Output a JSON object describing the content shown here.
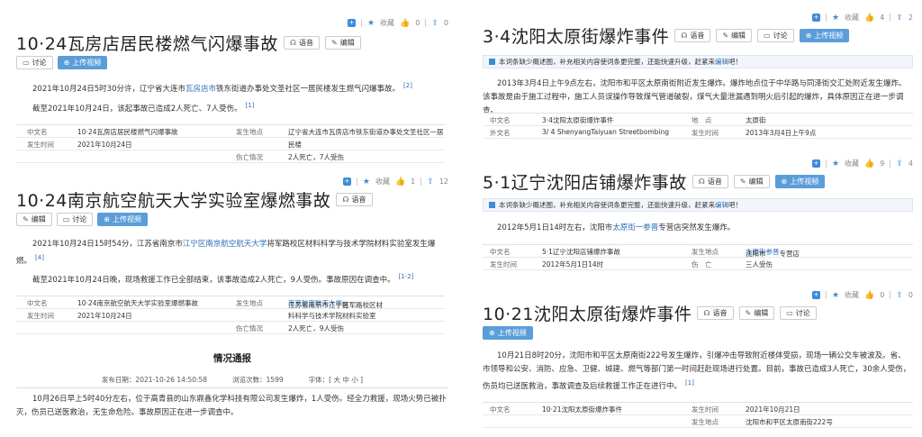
{
  "toolbar": {
    "favorite": "收藏"
  },
  "buttons": {
    "voice": "语音",
    "edit": "编辑",
    "discuss": "讨论",
    "upload_video": "上传视频"
  },
  "incomplete_note": {
    "prefix": "本词条缺少概述图，补充相关内容使词条更完整，还能快速升级，赶紧来",
    "link": "编辑",
    "suffix": "吧！"
  },
  "articles": [
    {
      "title": "10·24瓦房店居民楼燃气闪爆事故",
      "likes": "0",
      "shares": "0",
      "summary_pre": "2021年10月24日5时30分许，辽宁省大连市",
      "summary_link": "瓦房店市",
      "summary_post": "铁东街道办事处文圣社区一居民楼发生燃气闪爆事故。",
      "summary_ref": "[2]",
      "update": "截至2021年10月24日，该起事故已造成2人死亡、7人受伤。",
      "update_ref": "[1]",
      "info": [
        {
          "k1": "中文名",
          "v1": "10·24瓦房店居民楼燃气闪爆事故",
          "k2": "发生地点",
          "v2": "辽宁省大连市瓦房店市铁东街道办事处文圣社区一居"
        },
        {
          "k1": "发生时间",
          "v1": "2021年10月24日",
          "k2": "",
          "v2": "民楼"
        },
        {
          "k1": "",
          "v1": "",
          "k2": "伤亡情况",
          "v2": "2人死亡，7人受伤"
        }
      ]
    },
    {
      "title": "10·24南京航空航天大学实验室爆燃事故",
      "likes": "1",
      "shares": "12",
      "summary_pre": "2021年10月24日15时54分，江苏省南京市",
      "summary_link": "江宁区南京航空航天大学",
      "summary_post": "将军路校区材料科学与技术学院材料实验室发生爆燃。",
      "summary_ref": "[4]",
      "update": "截至2021年10月24日晚，现场救援工作已全部结束，该事故造成2人死亡，9人受伤。事故原因在调查中。",
      "update_ref": "[1-2]",
      "info": [
        {
          "k1": "中文名",
          "v1": "10·24南京航空航天大学实验室爆燃事故",
          "k2": "发生地点",
          "v2_pre": "江苏省南京市江宁区",
          "v2_link": "南京航空航天大学",
          "v2_post": "将军路校区材"
        },
        {
          "k1": "发生时间",
          "v1": "2021年10月24日",
          "k2": "",
          "v2": "料科学与技术学院材料实验室"
        },
        {
          "k1": "",
          "v1": "",
          "k2": "伤亡情况",
          "v2": "2人死亡，9人受伤"
        }
      ],
      "report": {
        "heading": "情况通报",
        "published": "发布日期：2021-10-26 14:50:58",
        "views": "浏览次数：1599",
        "font": "字体：[ 大 中 小 ]",
        "body": "10月26日早上5时40分左右，位于高青县的山东鼎鑫化学科技有限公司发生爆炸，1人受伤。经全力救援，现场火势已被扑灭，伤员已送医救治，无生命危险。事故原因正在进一步调查中。"
      }
    },
    {
      "title": "3·4沈阳太原街爆炸事件",
      "likes": "4",
      "shares": "2",
      "summary": "2013年3月4日上午9点左右，沈阳市和平区太原南街附近发生爆炸。爆炸地点位于中华路与同泽街交汇处附近发生爆炸。该事故是由于施工过程中，施工人员误操作导致煤气管道破裂，煤气大量泄漏遇到明火后引起的爆炸，具体原因正在进一步调查。",
      "info": [
        {
          "k1": "中文名",
          "v1": "3·4沈阳太原街爆炸事件",
          "k2": "地　点",
          "v2": "太原街"
        },
        {
          "k1": "外文名",
          "v1": "3/ 4 ShenyangTaiyuan Streetbombing",
          "k2": "发生时间",
          "v2": "2013年3月4日上午9点"
        }
      ]
    },
    {
      "title": "5·1辽宁沈阳店铺爆炸事故",
      "likes": "9",
      "shares": "4",
      "summary_pre": "2012年5月1日14时左右，沈阳市",
      "summary_link": "太原街一参晋",
      "summary_post": "专营店突然发生爆炸。",
      "info": [
        {
          "k1": "中文名",
          "v1": "5·1辽宁沈阳店铺爆炸事故",
          "k2": "发生地点",
          "v2_pre": "沈阳市",
          "v2_link": "太原街参晋",
          "v2_post": "专营店"
        },
        {
          "k1": "发生时间",
          "v1": "2012年5月1日14时",
          "k2": "伤　亡",
          "v2": "三人受伤"
        }
      ]
    },
    {
      "title": "10·21沈阳太原街爆炸事件",
      "likes": "0",
      "shares": "0",
      "summary": "10月21日8时20分，沈阳市和平区太原南街222号发生爆炸，引爆冲击导致附近楼体受损，现场一辆公交车被波及。省、市领导和公安、消防、应急、卫健、城建、燃气等部门第一时间赶赴现场进行处置。目前，事故已造成3人死亡，30余人受伤，伤员均已送医救治，事故调查及后续救援工作正在进行中。",
      "summary_ref": "[1]",
      "info": [
        {
          "k1": "中文名",
          "v1": "10·21沈阳太原街爆炸事件",
          "k2": "发生时间",
          "v2": "2021年10月21日"
        },
        {
          "k1": "",
          "v1": "",
          "k2": "发生地点",
          "v2": "沈阳市和平区太原南街222号"
        }
      ]
    }
  ]
}
